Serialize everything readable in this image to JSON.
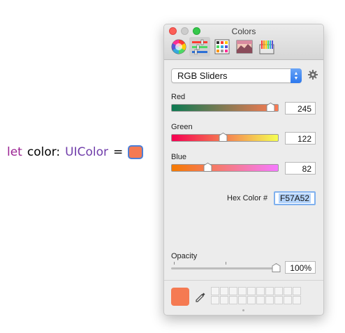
{
  "code": {
    "keyword": "let",
    "identifier": "color:",
    "type": "UIColor",
    "equals": "=",
    "literal_color": "#F57A52"
  },
  "window": {
    "title": "Colors",
    "toolbar": [
      {
        "name": "color-wheel",
        "selected": false
      },
      {
        "name": "color-sliders",
        "selected": true
      },
      {
        "name": "color-palettes",
        "selected": false
      },
      {
        "name": "image-palettes",
        "selected": false
      },
      {
        "name": "pencils",
        "selected": false
      }
    ],
    "mode": "RGB Sliders",
    "sliders": [
      {
        "label": "Red",
        "value": "245",
        "fraction": 0.961
      },
      {
        "label": "Green",
        "value": "122",
        "fraction": 0.478
      },
      {
        "label": "Blue",
        "value": "82",
        "fraction": 0.322
      }
    ],
    "hex": {
      "label": "Hex Color #",
      "value": "F57A52"
    },
    "opacity": {
      "label": "Opacity",
      "value": "100%",
      "fraction": 1.0
    },
    "current_color": "#F57A52",
    "swatch_cells": 20
  }
}
